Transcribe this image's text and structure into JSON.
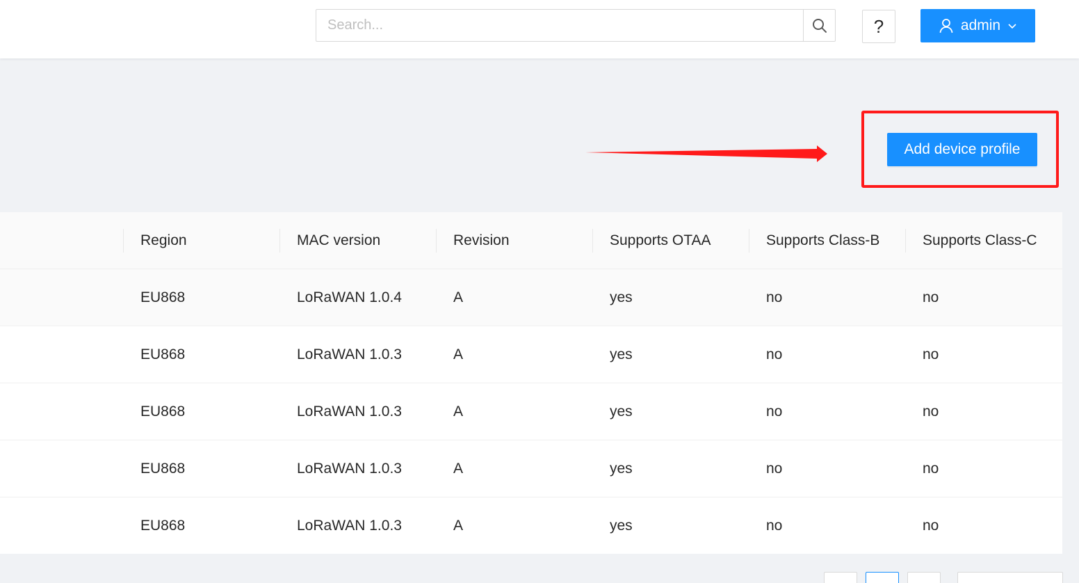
{
  "header": {
    "search_placeholder": "Search...",
    "help_label": "?",
    "user_label": "admin"
  },
  "toolbar": {
    "add_label": "Add device profile"
  },
  "table": {
    "columns": [
      "Region",
      "MAC version",
      "Revision",
      "Supports OTAA",
      "Supports Class-B",
      "Supports Class-C"
    ],
    "rows": [
      [
        "EU868",
        "LoRaWAN 1.0.4",
        "A",
        "yes",
        "no",
        "no"
      ],
      [
        "EU868",
        "LoRaWAN 1.0.3",
        "A",
        "yes",
        "no",
        "no"
      ],
      [
        "EU868",
        "LoRaWAN 1.0.3",
        "A",
        "yes",
        "no",
        "no"
      ],
      [
        "EU868",
        "LoRaWAN 1.0.3",
        "A",
        "yes",
        "no",
        "no"
      ],
      [
        "EU868",
        "LoRaWAN 1.0.3",
        "A",
        "yes",
        "no",
        "no"
      ]
    ]
  },
  "colors": {
    "primary": "#1890ff",
    "annotation": "#ff1a1a",
    "page_background": "#f0f2f5"
  }
}
